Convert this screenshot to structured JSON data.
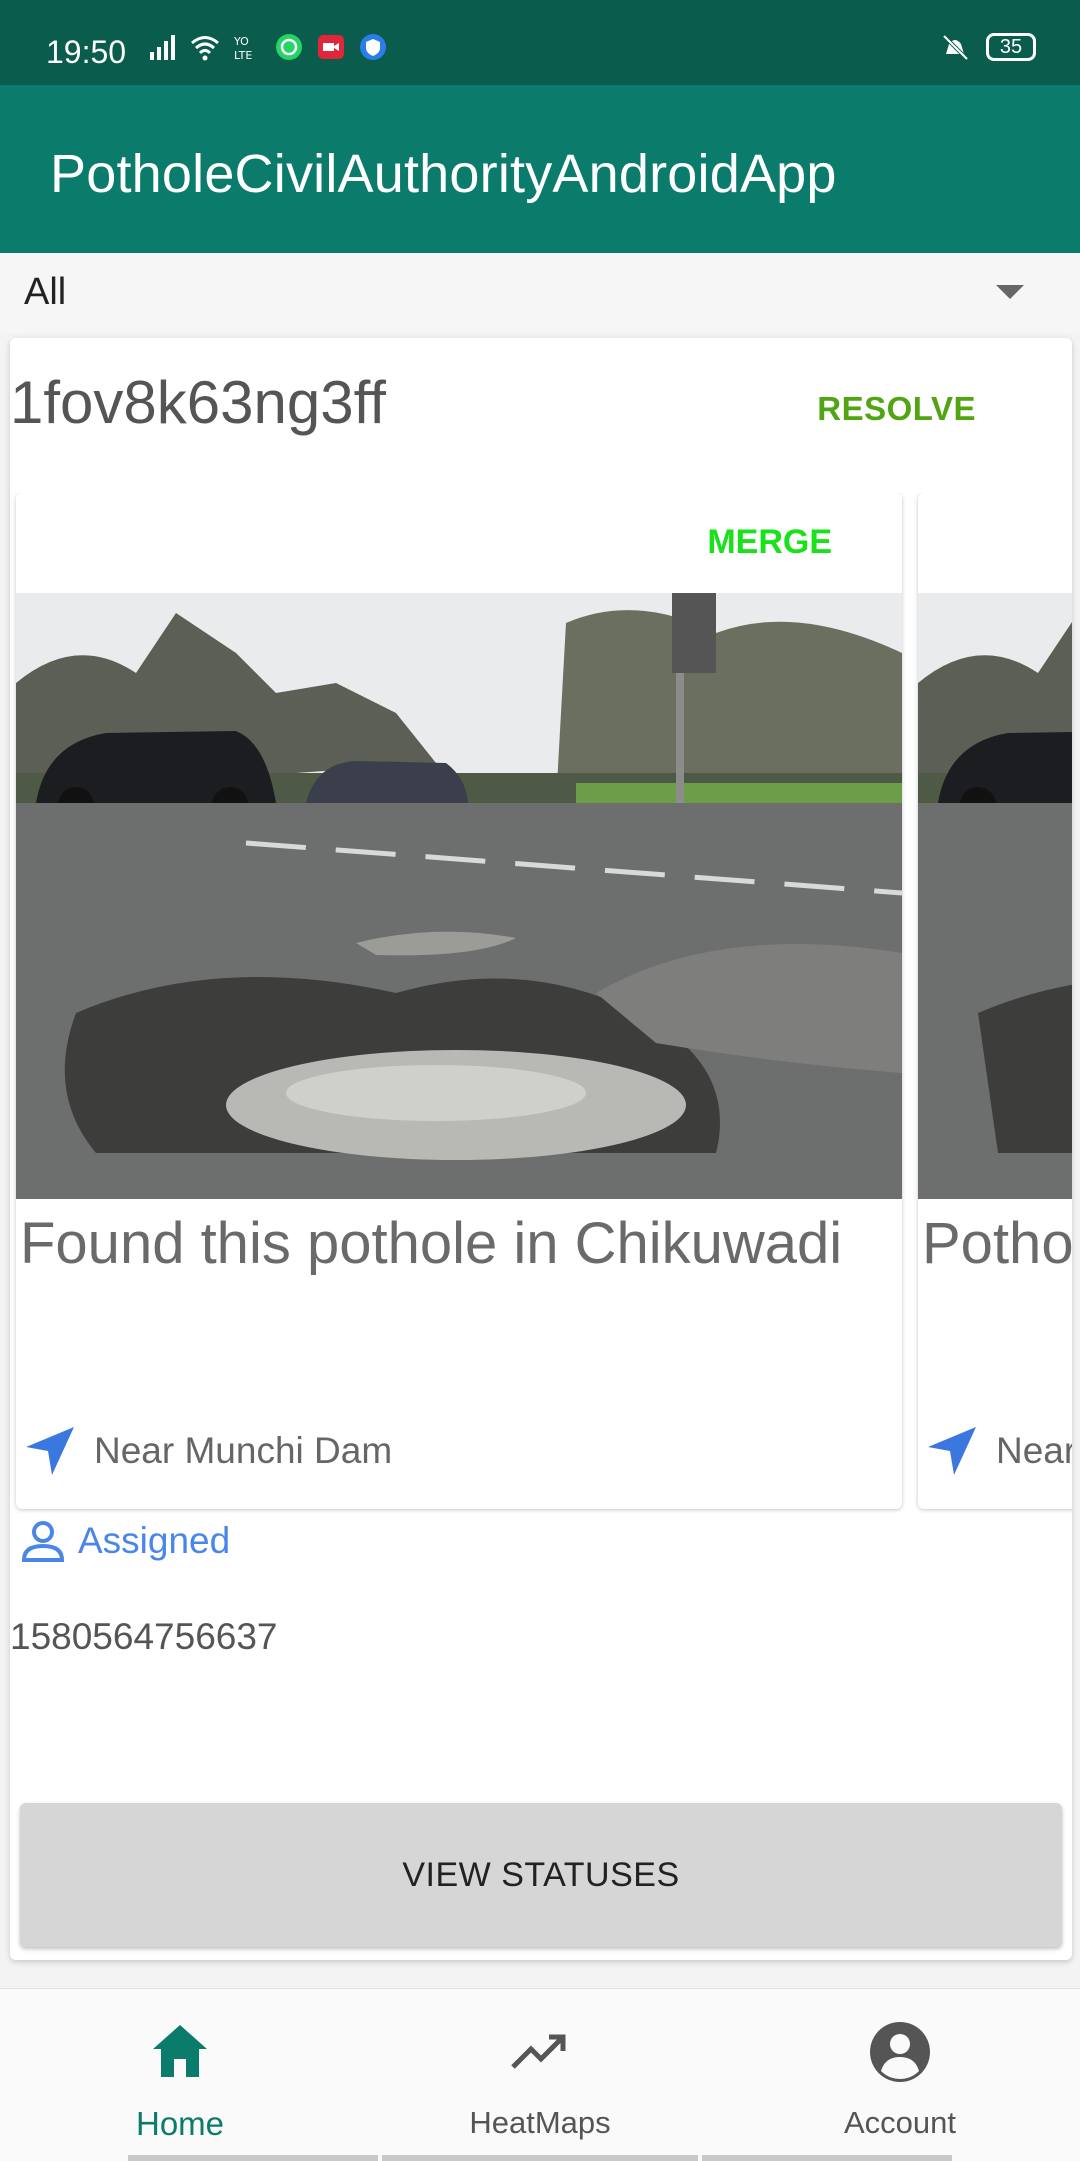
{
  "status_bar": {
    "time": "19:50",
    "battery": "35",
    "icons": [
      "signal-icon",
      "wifi-icon",
      "volte-icon",
      "whatsapp-icon",
      "video-call-icon",
      "shield-icon",
      "mute-vibrate-icon",
      "battery-icon"
    ]
  },
  "app_bar": {
    "title": "PotholeCivilAuthorityAndroidApp"
  },
  "filter": {
    "selected": "All"
  },
  "report": {
    "id": "1fov8k63ng3ff",
    "resolve_label": "RESOLVE",
    "assigned_label": "Assigned",
    "timestamp": "1580564756637",
    "view_statuses_label": "VIEW STATUSES",
    "posts": [
      {
        "merge_label": "MERGE",
        "description": "Found this pothole in Chikuwadi",
        "location": "Near Munchi Dam"
      },
      {
        "description": "Potho",
        "location": "Near"
      }
    ]
  },
  "colors": {
    "primary": "#0b7b6b",
    "status_bar": "#0a5c4d",
    "resolve": "#52a512",
    "merge": "#19e21b",
    "accent_blue": "#4a86e8"
  },
  "bottom_nav": {
    "items": [
      {
        "label": "Home",
        "icon": "home-icon",
        "active": true
      },
      {
        "label": "HeatMaps",
        "icon": "trending-up-icon",
        "active": false
      },
      {
        "label": "Account",
        "icon": "account-circle-icon",
        "active": false
      }
    ]
  }
}
